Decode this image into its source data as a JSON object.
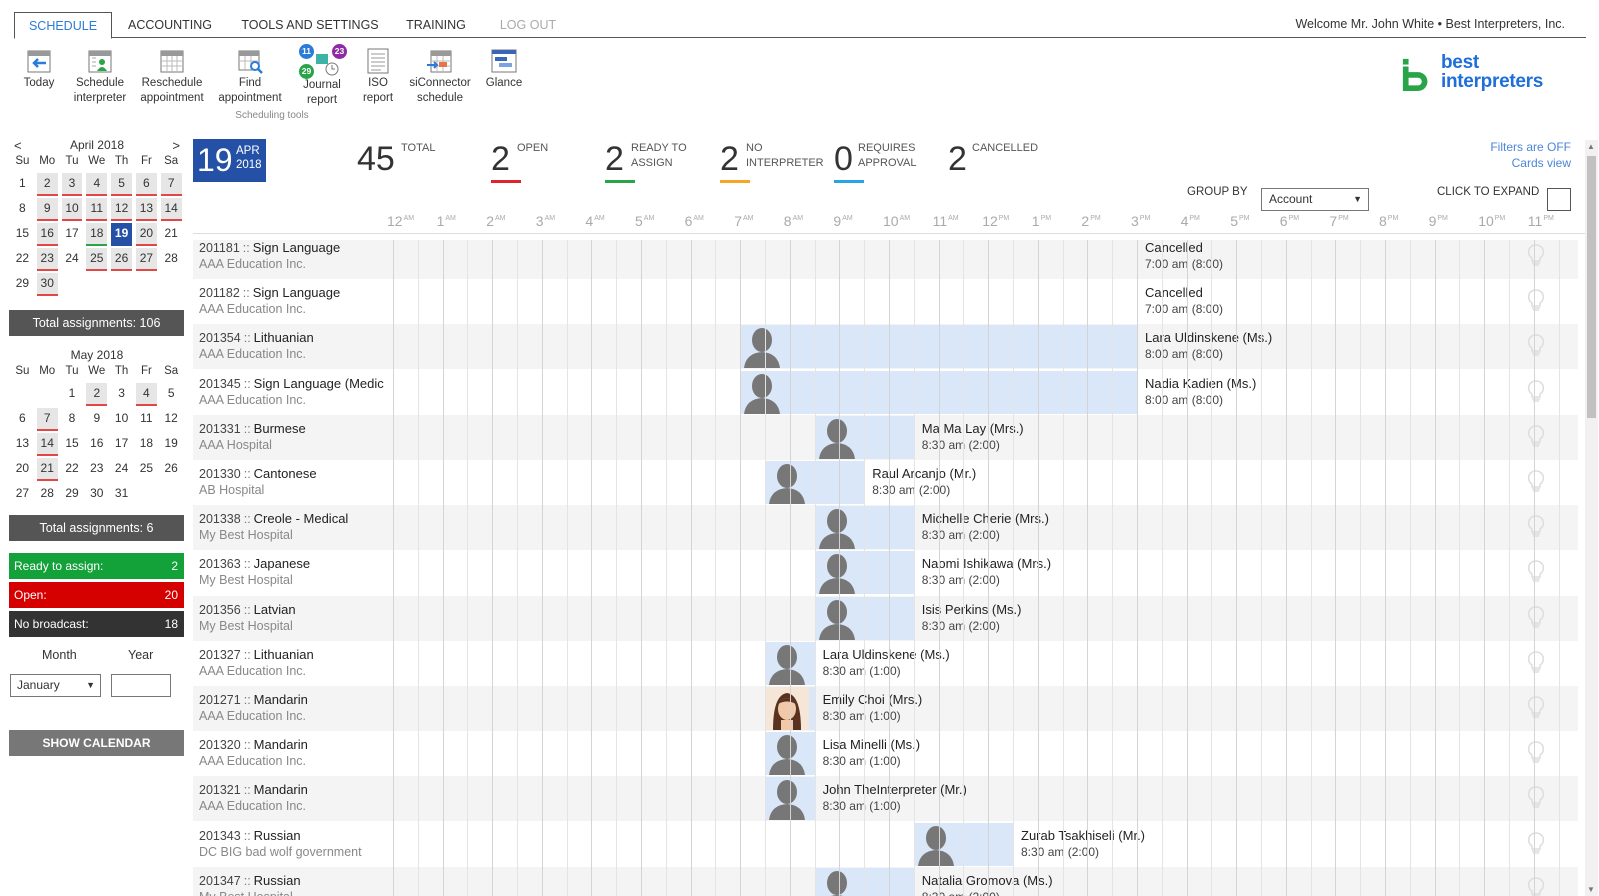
{
  "tabs": [
    {
      "label": "SCHEDULE",
      "state": "active"
    },
    {
      "label": "ACCOUNTING",
      "state": "normal"
    },
    {
      "label": "TOOLS AND SETTINGS",
      "state": "normal"
    },
    {
      "label": "TRAINING",
      "state": "normal"
    },
    {
      "label": "LOG OUT",
      "state": "disabled"
    }
  ],
  "welcome": "Welcome Mr. John White • Best Interpreters, Inc.",
  "toolbar": {
    "today": "Today",
    "schedule_1": "Schedule",
    "schedule_2": "interpreter",
    "reschedule_1": "Reschedule",
    "reschedule_2": "appointment",
    "find_1": "Find",
    "find_2": "appointment",
    "journal_1": "Journal",
    "journal_2": "report",
    "iso_1": "ISO",
    "iso_2": "report",
    "siconnector_1": "siConnector",
    "siconnector_2": "schedule",
    "glance": "Glance",
    "caption": "Scheduling tools",
    "badges": {
      "blue": "11",
      "purple": "23",
      "green": "29"
    }
  },
  "logo": {
    "line1": "best",
    "line2": "interpreters"
  },
  "april": {
    "title": "April 2018",
    "prev": "<",
    "next": ">",
    "total": "Total assignments: 106"
  },
  "may": {
    "title": "May 2018",
    "total": "Total assignments: 6"
  },
  "dow": [
    "Su",
    "Mo",
    "Tu",
    "We",
    "Th",
    "Fr",
    "Sa"
  ],
  "stats": {
    "ready_label": "Ready to assign:",
    "ready_value": "2",
    "open_label": "Open:",
    "open_value": "20",
    "nob_label": "No broadcast:",
    "nob_value": "18"
  },
  "form": {
    "month_label": "Month",
    "year_label": "Year",
    "month_value": "January",
    "year_value": "",
    "show_calendar": "SHOW CALENDAR"
  },
  "header": {
    "day": "19",
    "month": "APR",
    "year": "2018",
    "total_n": "45",
    "total_l": "TOTAL",
    "open_n": "2",
    "open_l": "OPEN",
    "ready_n": "2",
    "ready_l1": "READY TO",
    "ready_l2": "ASSIGN",
    "noint_n": "2",
    "noint_l1": "NO",
    "noint_l2": "INTERPRETER",
    "req_n": "0",
    "req_l1": "REQUIRES",
    "req_l2": "APPROVAL",
    "canc_n": "2",
    "canc_l": "CANCELLED",
    "filters": "Filters are OFF",
    "cards": "Cards view",
    "group_by": "GROUP BY",
    "group_value": "Account",
    "expand": "CLICK TO EXPAND"
  },
  "colors": {
    "open": "#e0242f",
    "ready": "#2aa448",
    "noint": "#f5a623",
    "req": "#29a3e8",
    "accent": "#2451a6"
  },
  "hours": [
    {
      "n": "12",
      "p": "AM"
    },
    {
      "n": "1",
      "p": "AM"
    },
    {
      "n": "2",
      "p": "AM"
    },
    {
      "n": "3",
      "p": "AM"
    },
    {
      "n": "4",
      "p": "AM"
    },
    {
      "n": "5",
      "p": "AM"
    },
    {
      "n": "6",
      "p": "AM"
    },
    {
      "n": "7",
      "p": "AM"
    },
    {
      "n": "8",
      "p": "AM"
    },
    {
      "n": "9",
      "p": "AM"
    },
    {
      "n": "10",
      "p": "AM"
    },
    {
      "n": "11",
      "p": "AM"
    },
    {
      "n": "12",
      "p": "PM"
    },
    {
      "n": "1",
      "p": "PM"
    },
    {
      "n": "2",
      "p": "PM"
    },
    {
      "n": "3",
      "p": "PM"
    },
    {
      "n": "4",
      "p": "PM"
    },
    {
      "n": "5",
      "p": "PM"
    },
    {
      "n": "6",
      "p": "PM"
    },
    {
      "n": "7",
      "p": "PM"
    },
    {
      "n": "8",
      "p": "PM"
    },
    {
      "n": "9",
      "p": "PM"
    },
    {
      "n": "10",
      "p": "PM"
    },
    {
      "n": "11",
      "p": "PM"
    }
  ],
  "rows": [
    {
      "id": "201181",
      "lang": "Sign Language",
      "account": "AAA Education Inc.",
      "status": "cancelled",
      "start": 7,
      "end": 15,
      "label": "Cancelled",
      "time": "7:00 am (8:00)"
    },
    {
      "id": "201182",
      "lang": "Sign Language",
      "account": "AAA Education Inc.",
      "status": "cancelled",
      "start": 7,
      "end": 15,
      "label": "Cancelled",
      "time": "7:00 am (8:00)"
    },
    {
      "id": "201354",
      "lang": "Lithuanian",
      "account": "AAA Education Inc.",
      "status": "assigned",
      "start": 7,
      "end": 15,
      "label": "Lara Uldinskene (Ms.)",
      "time": "8:00 am (8:00)"
    },
    {
      "id": "201345",
      "lang": "Sign Language (Medic",
      "account": "AAA Education Inc.",
      "status": "assigned",
      "start": 7,
      "end": 15,
      "label": "Nadia Kadien (Ms.)",
      "time": "8:00 am (8:00)"
    },
    {
      "id": "201331",
      "lang": "Burmese",
      "account": "AAA Hospital",
      "status": "assigned",
      "start": 8.5,
      "end": 10.5,
      "label": "Ma Ma Lay (Mrs.)",
      "time": "8:30 am (2:00)"
    },
    {
      "id": "201330",
      "lang": "Cantonese",
      "account": "AB Hospital",
      "status": "assigned",
      "start": 7.5,
      "end": 9.5,
      "label": "Raul Arcanjo (Mr.)",
      "time": "8:30 am (2:00)"
    },
    {
      "id": "201338",
      "lang": "Creole - Medical",
      "account": "My Best Hospital",
      "status": "assigned",
      "start": 8.5,
      "end": 10.5,
      "label": "Michelle Cherie (Mrs.)",
      "time": "8:30 am (2:00)"
    },
    {
      "id": "201363",
      "lang": "Japanese",
      "account": "My Best Hospital",
      "status": "assigned",
      "start": 8.5,
      "end": 10.5,
      "label": "Naomi Ishikawa (Mrs.)",
      "time": "8:30 am (2:00)"
    },
    {
      "id": "201356",
      "lang": "Latvian",
      "account": "My Best Hospital",
      "status": "assigned",
      "start": 8.5,
      "end": 10.5,
      "label": "Isis Perkins (Ms.)",
      "time": "8:30 am (2:00)"
    },
    {
      "id": "201327",
      "lang": "Lithuanian",
      "account": "AAA Education Inc.",
      "status": "assigned",
      "start": 7.5,
      "end": 8.5,
      "label": "Lara Uldinskene (Ms.)",
      "time": "8:30 am (1:00)"
    },
    {
      "id": "201271",
      "lang": "Mandarin",
      "account": "AAA Education Inc.",
      "status": "assigned",
      "start": 7.5,
      "end": 8.5,
      "label": "Emily Choi (Mrs.)",
      "time": "8:30 am (1:00)",
      "photo": true
    },
    {
      "id": "201320",
      "lang": "Mandarin",
      "account": "AAA Education Inc.",
      "status": "assigned",
      "start": 7.5,
      "end": 8.5,
      "label": "Lisa Minelli (Ms.)",
      "time": "8:30 am (1:00)"
    },
    {
      "id": "201321",
      "lang": "Mandarin",
      "account": "AAA Education Inc.",
      "status": "assigned",
      "start": 7.5,
      "end": 8.5,
      "label": "John TheInterpreter (Mr.)",
      "time": "8:30 am (1:00)"
    },
    {
      "id": "201343",
      "lang": "Russian",
      "account": "DC BIG bad wolf government",
      "status": "assigned",
      "start": 10.5,
      "end": 12.5,
      "label": "Zurab Tsakhiseli (Mr.)",
      "time": "8:30 am (2:00)"
    },
    {
      "id": "201347",
      "lang": "Russian",
      "account": "My Best Hospital",
      "status": "assigned",
      "start": 8.5,
      "end": 10.5,
      "label": "Natalia Gromova (Ms.)",
      "time": "8:30 am (2:00)"
    }
  ]
}
